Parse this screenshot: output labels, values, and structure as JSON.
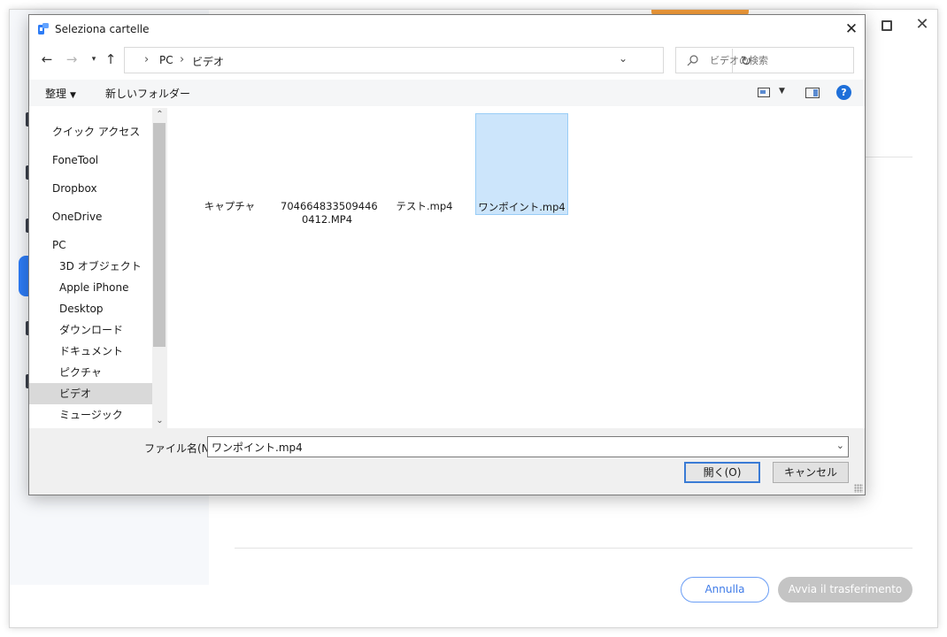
{
  "app": {
    "cancel_label": "Annulla",
    "start_label": "Avvia il trasferimento",
    "accent_color": "#2d7cf6"
  },
  "dialog": {
    "title": "Seleziona cartelle",
    "breadcrumb": [
      "PC",
      "ビデオ"
    ],
    "search_placeholder": "ビデオの検索",
    "toolbar": {
      "organize_label": "整理",
      "new_folder_label": "新しいフォルダー",
      "help_label": "?"
    },
    "nav_items": [
      {
        "label": "クイック アクセス"
      },
      {
        "label": "FoneTool"
      },
      {
        "label": "Dropbox"
      },
      {
        "label": "OneDrive"
      },
      {
        "label": "PC"
      },
      {
        "label": "3D オブジェクト"
      },
      {
        "label": "Apple iPhone"
      },
      {
        "label": "Desktop"
      },
      {
        "label": "ダウンロード"
      },
      {
        "label": "ドキュメント"
      },
      {
        "label": "ピクチャ"
      },
      {
        "label": "ビデオ"
      },
      {
        "label": "ミュージック"
      }
    ],
    "selected_nav": "ビデオ",
    "files": [
      {
        "name": "キャプチャ"
      },
      {
        "name": "704664833509446 0412.MP4"
      },
      {
        "name": "テスト.mp4"
      },
      {
        "name": "ワンポイント.mp4"
      }
    ],
    "selected_file": "ワンポイント.mp4",
    "filename_label": "ファイル名(N):",
    "filename_value": "ワンポイント.mp4",
    "open_label": "開く(O)",
    "cancel_label": "キャンセル"
  }
}
